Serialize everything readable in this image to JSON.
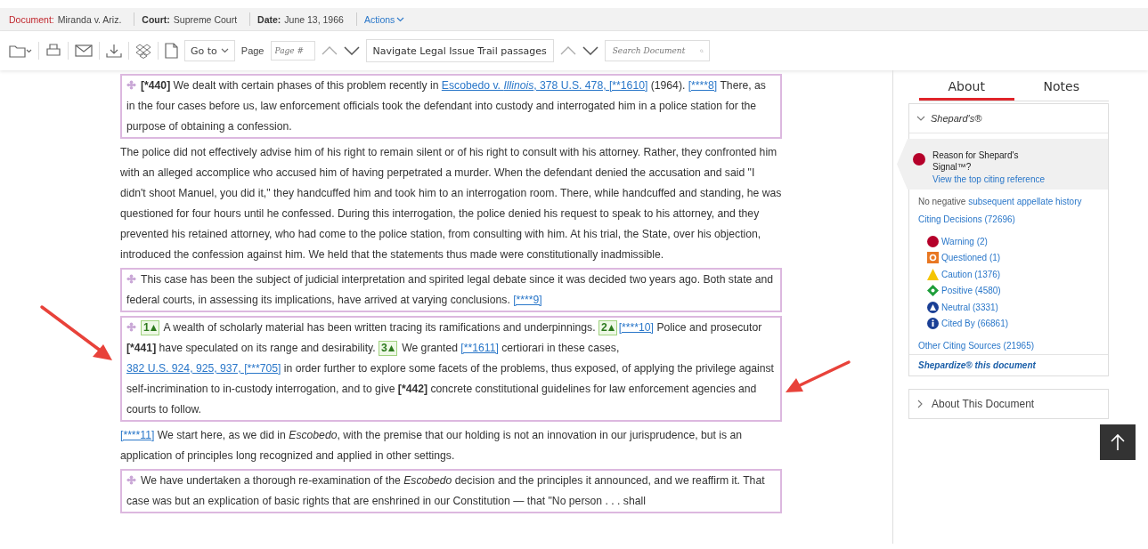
{
  "header": {
    "document_label": "Document:",
    "document": "Miranda v. Ariz.",
    "court_label": "Court:",
    "court": "Supreme Court",
    "date_label": "Date:",
    "date": "June 13, 1966",
    "actions": "Actions"
  },
  "toolbar": {
    "goto": "Go to",
    "page_label": "Page",
    "page_placeholder": "Page #",
    "trail_button": "Navigate Legal Issue Trail passages",
    "search_placeholder": "Search Document"
  },
  "paragraphs": [
    {
      "boxed": true,
      "segments": [
        {
          "kind": "text",
          "text": "**[*440]** We dealt with certain phases of this problem recently in "
        },
        {
          "kind": "link",
          "text": "Escobedo v. *Illinois*, 378 U.S. 478, [**1610]"
        },
        {
          "kind": "text",
          "text": " (1964). "
        },
        {
          "kind": "link",
          "text": "[****8]"
        },
        {
          "kind": "text",
          "text": " There, as in the four cases before us, law enforcement officials took the defendant into custody and interrogated him in a police station for the purpose of obtaining a confession."
        }
      ]
    },
    {
      "boxed": false,
      "segments": [
        {
          "kind": "text",
          "text": "The police did not effectively advise him of his right to remain silent or of his right to consult with his attorney. Rather, they confronted him with an alleged accomplice who accused him of having perpetrated a murder. When the defendant denied the accusation and said \"I didn't shoot Manuel, you did it,\" they handcuffed him and took him to an interrogation room. There, while handcuffed and standing, he was questioned for four hours until he confessed. During this interrogation, the police denied his request to speak to his attorney, and they prevented his retained attorney, who had come to the police station, from consulting with him. At his trial, the State, over his objection, introduced the confession against him. We held that the statements thus made were constitutionally inadmissible."
        }
      ]
    },
    {
      "boxed": true,
      "segments": [
        {
          "kind": "text",
          "text": "This case has been the subject of judicial interpretation and spirited legal debate since it was decided two years ago. Both state and federal courts, in assessing its implications, have arrived at varying conclusions. "
        },
        {
          "kind": "link",
          "text": "[****9]"
        }
      ]
    },
    {
      "boxed": true,
      "segments": [
        {
          "kind": "badge",
          "text": "1"
        },
        {
          "kind": "text",
          "text": " A wealth of scholarly material has been written tracing its ramifications and underpinnings. "
        },
        {
          "kind": "badge",
          "text": "2"
        },
        {
          "kind": "link",
          "text": "[****10]"
        },
        {
          "kind": "text",
          "text": " Police and prosecutor **[*441]** have speculated on its range and desirability. "
        },
        {
          "kind": "badge",
          "text": "3"
        },
        {
          "kind": "text",
          "text": " We granted "
        },
        {
          "kind": "link",
          "text": "[**1611]"
        },
        {
          "kind": "text",
          "text": " certiorari in these cases, "
        },
        {
          "kind": "link",
          "text": "382 U.S. 924, 925, 937, [***705]"
        },
        {
          "kind": "text",
          "text": " in order further to explore some facets of the problems, thus exposed, of applying the privilege against self-incrimination to in-custody interrogation, and to give **[*442]** concrete constitutional guidelines for law enforcement agencies and courts to follow."
        }
      ]
    },
    {
      "boxed": false,
      "segments": [
        {
          "kind": "link",
          "text": "[****11]"
        },
        {
          "kind": "text",
          "text": " We start here, as we did in *Escobedo*, with the premise that our holding is not an innovation in our jurisprudence, but is an application of principles long recognized and applied in other settings."
        }
      ]
    },
    {
      "boxed": true,
      "segments": [
        {
          "kind": "text",
          "text": "We have undertaken a thorough re-examination of the *Escobedo* decision and the principles it announced, and we reaffirm it. That case was but an explication of basic rights that are enshrined in our Constitution — that \"No person . . . shall"
        }
      ]
    }
  ],
  "sidebar": {
    "tabs": [
      {
        "label": "About",
        "selected": true
      },
      {
        "label": "Notes",
        "selected": false
      }
    ],
    "shepards": {
      "title": "Shepard's®",
      "expanded": true,
      "signal": {
        "kind": "warning"
      },
      "signal_question": "Reason for Shepard's Signal™?",
      "signal_link": "View the top citing reference",
      "history_text": "No negative ",
      "history_link": "subsequent appellate history",
      "citing": "Citing Decisions (72696)",
      "signals": [
        {
          "kind": "warning",
          "label": "Warning (2)",
          "color": "#b5002a"
        },
        {
          "kind": "questioned",
          "label": "Questioned (1)",
          "color": "#e87722"
        },
        {
          "kind": "caution",
          "label": "Caution (1376)",
          "color": "#f5c400"
        },
        {
          "kind": "positive",
          "label": "Positive (4580)",
          "color": "#1e9e3a"
        },
        {
          "kind": "neutral",
          "label": "Neutral (3331)",
          "color": "#1a3f95"
        },
        {
          "kind": "cited_by",
          "label": "Cited By (66861)",
          "color": "#1a3f95"
        }
      ],
      "other": "Other Citing Sources (21965)",
      "shepardize": "Shepardize® this document"
    },
    "about": {
      "title": "About This Document",
      "expanded": false
    }
  }
}
